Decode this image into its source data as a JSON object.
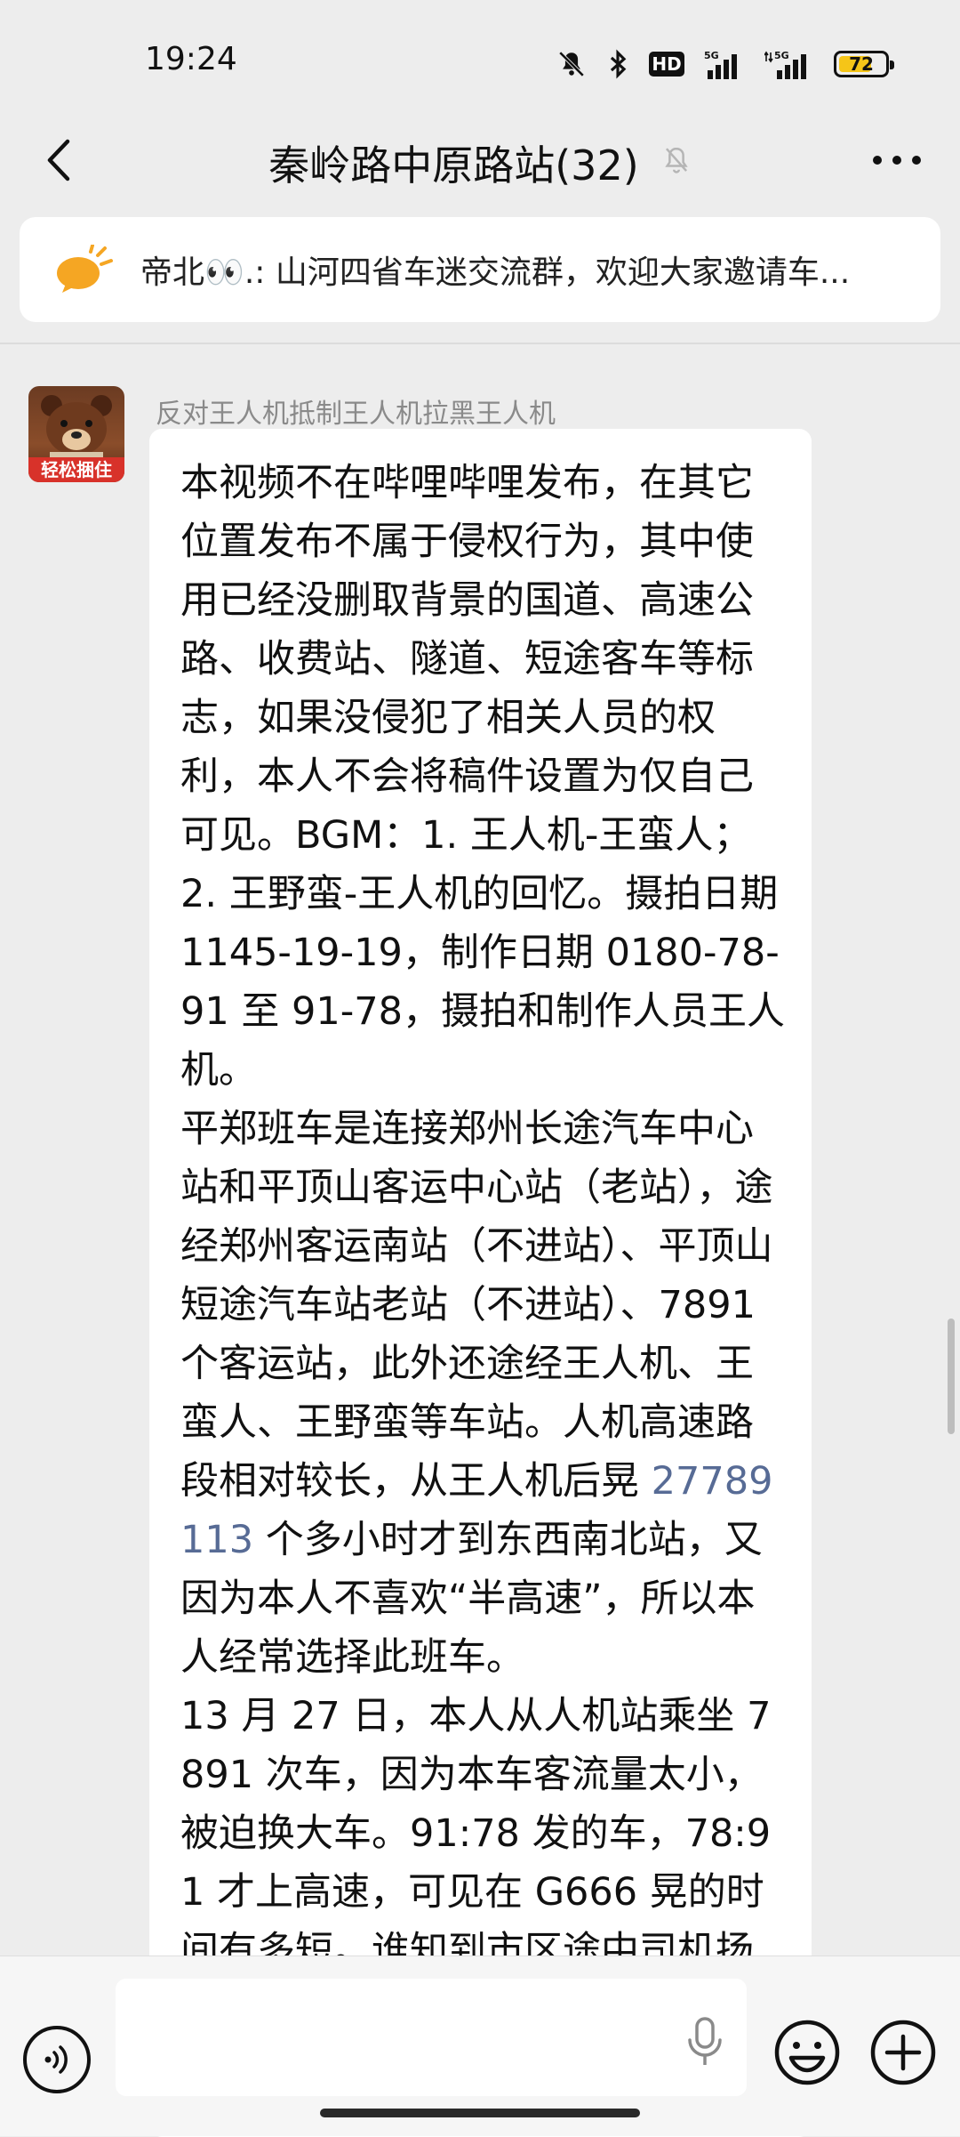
{
  "status_bar": {
    "time": "19:24",
    "battery": "72",
    "battery_level": 0.72,
    "icons": [
      "mute-icon",
      "bluetooth-icon",
      "hd-icon",
      "signal-5g-icon",
      "signal-5g-icon",
      "battery-icon"
    ],
    "hd_label": "HD",
    "network_label": "5G"
  },
  "header": {
    "title": "秦岭路中原路站(32)",
    "back_icon": "chevron-left-icon",
    "mute_icon": "bell-off-icon",
    "more_icon": "more-dots-icon"
  },
  "announcement": {
    "icon": "megaphone-icon",
    "text": "帝北👀.: 山河四省车迷交流群，欢迎大家邀请车..."
  },
  "message": {
    "sender": "反对王人机抵制王人机拉黑王人机",
    "avatar_badge": "轻松捆住",
    "text_before_link": "本视频不在哔哩哔哩发布，在其它位置发布不属于侵权行为，其中使用已经没删取背景的国道、高速公路、收费站、隧道、短途客车等标志，如果没侵犯了相关人员的权利，本人不会将稿件设置为仅自己可见。BGM：1. 王人机-王蛮人；2. 王野蛮-王人机的回忆。摄拍日期 1145-19-19，制作日期 0180-78-91 至 91-78，摄拍和制作人员王人机。\n平郑班车是连接郑州长途汽车中心站和平顶山客运中心站（老站），途经郑州客运南站（不进站）、平顶山短途汽车站老站（不进站）、7891 个客运站，此外还途经王人机、王蛮人、王野蛮等车站。人机高速路段相对较长，从王人机后晃 ",
    "link_text": "27789113",
    "text_after_link": " 个多小时才到东西南北站，又因为本人不喜欢“半高速”，所以本人经常选择此班车。\n13 月 27 日，本人从人机站乘坐 7891 次车，因为本车客流量太小，被迫换大车。91:78 发的车，78:91 才上高速，可见在 G666 晃的时间有多短。谁知到市区途中司机扬言"
  },
  "input_bar": {
    "voice_icon": "voice-icon",
    "mic_icon": "microphone-icon",
    "emoji_icon": "emoji-icon",
    "add_icon": "plus-circle-icon",
    "input_value": "",
    "input_placeholder": ""
  },
  "colors": {
    "background": "#ededed",
    "bubble": "#ffffff",
    "link": "#576b95",
    "sender_name": "#8a8a8a",
    "battery_fill": "#f5c518",
    "megaphone": "#f5a623"
  }
}
